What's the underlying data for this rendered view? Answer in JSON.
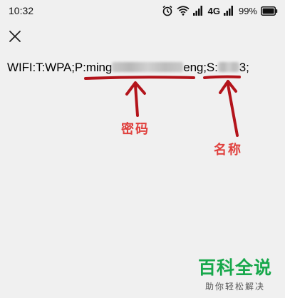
{
  "status_bar": {
    "time": "10:32",
    "network": "4G",
    "battery": "99%"
  },
  "content": {
    "text_prefix": "WIFI:T:WPA;P:ming",
    "text_mid": "eng;S:",
    "text_suffix": "3;"
  },
  "annotations": {
    "password_label": "密码",
    "name_label": "名称",
    "color": "#e0413e"
  },
  "watermark": {
    "title": "百科全说",
    "subtitle": "助你轻松解决"
  }
}
